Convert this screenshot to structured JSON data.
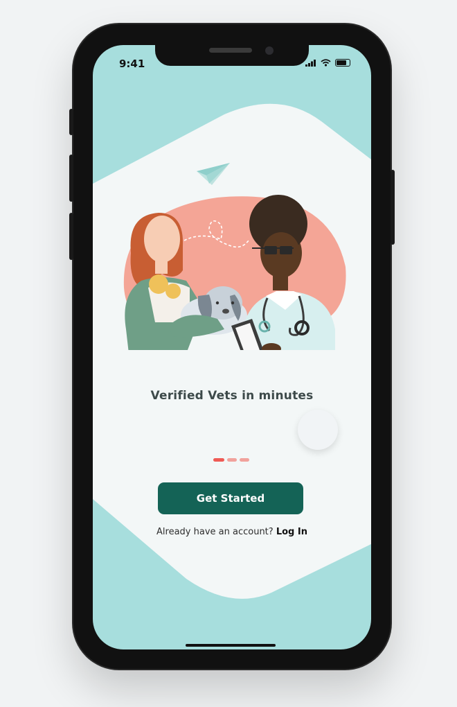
{
  "status_bar": {
    "time": "9:41"
  },
  "onboarding": {
    "title": "Verified Vets in minutes",
    "page_indicator": {
      "total": 3,
      "active": 1
    }
  },
  "actions": {
    "primary_label": "Get Started",
    "account_prompt": "Already have an account?",
    "login_label": "Log In"
  },
  "colors": {
    "background_teal": "#a7dedd",
    "card": "#f3f7f7",
    "primary_button": "#146356",
    "dot_active": "#ef5b55",
    "dot_inactive": "#f1a29c",
    "blob": "#f4a596"
  },
  "icons": [
    "signal-icon",
    "wifi-icon",
    "battery-icon",
    "paper-plane-icon"
  ]
}
